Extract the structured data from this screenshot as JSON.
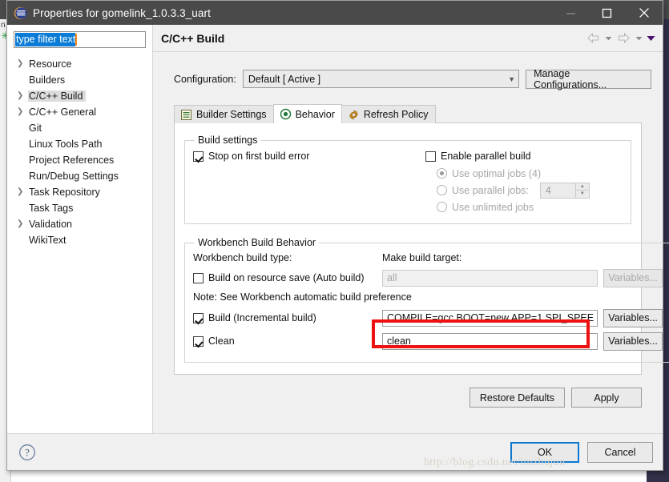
{
  "window": {
    "title": "Properties for gomelink_1.0.3.3_uart",
    "app_icon": "eclipse-logo-icon",
    "controls": {
      "minimize": "minimize-icon",
      "maximize": "maximize-icon",
      "close": "close-icon"
    }
  },
  "colors": {
    "titlebar_bg": "#4a4a4a",
    "dialog_bg": "#f0f0f0",
    "accent_selection": "#0a7bd6",
    "focus_border": "#0a78d0",
    "highlight_red": "#ee1111",
    "caret_orange": "#ff8c1a"
  },
  "sidebar": {
    "filter": {
      "value": "type filter text",
      "placeholder": "type filter text",
      "selected": true
    },
    "items": [
      {
        "label": "Resource",
        "expandable": true,
        "selected": false
      },
      {
        "label": "Builders",
        "expandable": false,
        "selected": false
      },
      {
        "label": "C/C++ Build",
        "expandable": true,
        "selected": true
      },
      {
        "label": "C/C++ General",
        "expandable": true,
        "selected": false
      },
      {
        "label": "Git",
        "expandable": false,
        "selected": false
      },
      {
        "label": "Linux Tools Path",
        "expandable": false,
        "selected": false
      },
      {
        "label": "Project References",
        "expandable": false,
        "selected": false
      },
      {
        "label": "Run/Debug Settings",
        "expandable": false,
        "selected": false
      },
      {
        "label": "Task Repository",
        "expandable": true,
        "selected": false
      },
      {
        "label": "Task Tags",
        "expandable": false,
        "selected": false
      },
      {
        "label": "Validation",
        "expandable": true,
        "selected": false
      },
      {
        "label": "WikiText",
        "expandable": false,
        "selected": false
      }
    ]
  },
  "content": {
    "page_title": "C/C++ Build",
    "nav": {
      "back_icon": "arrow-left-icon",
      "back_menu_icon": "chevron-down-icon",
      "forward_icon": "arrow-right-icon",
      "forward_menu_icon": "chevron-down-icon",
      "overflow_icon": "triangle-down-icon"
    },
    "configuration": {
      "label": "Configuration:",
      "selected": "Default  [ Active ]",
      "options": [
        "Default  [ Active ]"
      ],
      "chevron_icon": "chevron-down-icon",
      "manage_button": "Manage Configurations..."
    },
    "tabs": [
      {
        "label": "Builder Settings",
        "icon": "list-lines-icon",
        "active": false
      },
      {
        "label": "Behavior",
        "icon": "target-circle-icon",
        "active": true
      },
      {
        "label": "Refresh Policy",
        "icon": "refresh-arrows-icon",
        "active": false
      }
    ],
    "build_settings": {
      "legend": "Build settings",
      "stop_on_first_error": {
        "label": "Stop on first build error",
        "checked": true
      },
      "enable_parallel_build": {
        "label": "Enable parallel build",
        "checked": false
      },
      "parallel_options": [
        {
          "label": "Use optimal jobs (4)",
          "selected": true,
          "enabled": false
        },
        {
          "label": "Use parallel jobs:",
          "selected": false,
          "enabled": false,
          "spinner_value": "4"
        },
        {
          "label": "Use unlimited jobs",
          "selected": false,
          "enabled": false
        }
      ]
    },
    "workbench_build_behavior": {
      "legend": "Workbench Build Behavior",
      "build_type_label": "Workbench build type:",
      "make_target_label": "Make build target:",
      "note": "Note: See Workbench automatic build preference",
      "rows": [
        {
          "checkbox_label": "Build on resource save (Auto build)",
          "checked": false,
          "field_value": "all",
          "field_enabled": false,
          "variables_button": "Variables...",
          "variables_enabled": false,
          "highlighted": false
        },
        {
          "checkbox_label": "Build (Incremental build)",
          "checked": true,
          "field_value": "COMPILE=gcc BOOT=new APP=1 SPI_SPEE",
          "field_enabled": true,
          "variables_button": "Variables...",
          "variables_enabled": true,
          "highlighted": true
        },
        {
          "checkbox_label": "Clean",
          "checked": true,
          "field_value": "clean",
          "field_enabled": true,
          "variables_button": "Variables...",
          "variables_enabled": true,
          "highlighted": false
        }
      ]
    },
    "actions": {
      "restore_defaults": "Restore Defaults",
      "apply": "Apply"
    }
  },
  "footer": {
    "help_icon": "question-mark-circle-icon",
    "ok": "OK",
    "cancel": "Cancel",
    "watermark": "http://blog.csdn.net/imzhujun"
  }
}
